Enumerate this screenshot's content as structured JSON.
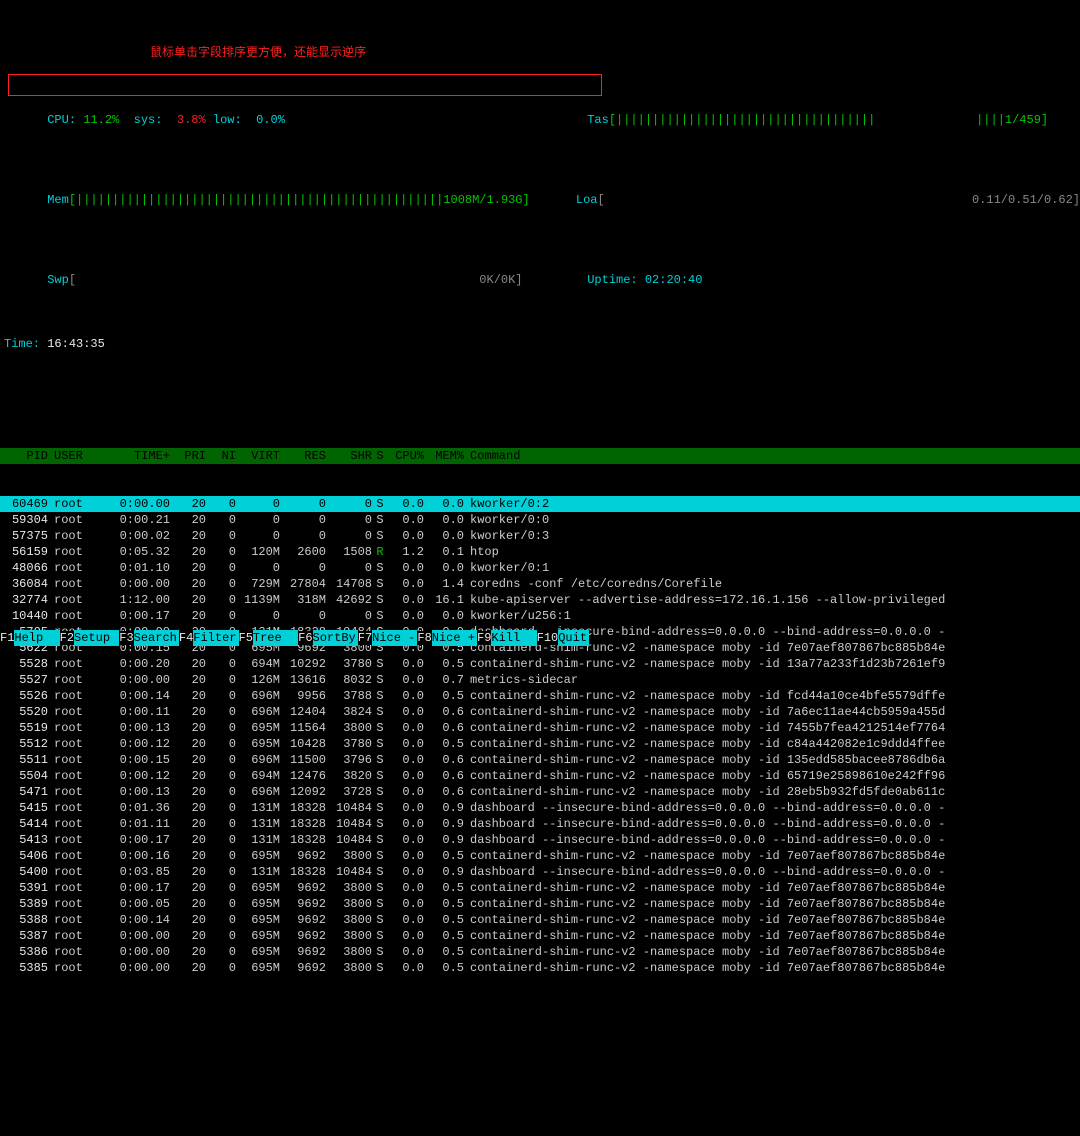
{
  "meters": {
    "cpu_label": "CPU:",
    "cpu_user": "11.2%",
    "sys_label": "sys:",
    "sys_val": "3.8%",
    "low_label": "low:",
    "low_val": "0.0%",
    "tas_label": "Tas",
    "tas_bar": "[||||||||||||||||||||||||||||||||||||              ||||1/459]",
    "mem_label": "Mem",
    "mem_bar": "[|||||||||||||||||||||||||||||||||||||||||||||||||||1008M/1.93G]",
    "mem_right": "0.11/0.51/0.62]",
    "loa_label": "Loa",
    "loa_bar": "[                                                   ",
    "swp_label": "Swp",
    "swp_bar": "[                                                        0K/0K]",
    "uptime_label": "Uptime:",
    "uptime_val": "02:20:40",
    "time_label": "Time:",
    "time_val": "16:43:35"
  },
  "annotation": "鼠标单击字段排序更方便，还能显示逆序",
  "columns": {
    "pid": "PID",
    "user": "USER",
    "time": "TIME+",
    "pri": "PRI",
    "ni": "NI",
    "virt": "VIRT",
    "res": "RES",
    "shr": "SHR",
    "s": "S",
    "cpu": "CPU%",
    "mem": "MEM%",
    "cmd": "Command"
  },
  "processes": [
    {
      "pid": "60469",
      "user": "root",
      "time": "0:00.00",
      "pri": "20",
      "ni": "0",
      "virt": "0",
      "res": "0",
      "shr": "0",
      "s": "S",
      "cpu": "0.0",
      "mem": "0.0",
      "cmd": "kworker/0:2",
      "hl": true
    },
    {
      "pid": "59304",
      "user": "root",
      "time": "0:00.21",
      "pri": "20",
      "ni": "0",
      "virt": "0",
      "res": "0",
      "shr": "0",
      "s": "S",
      "cpu": "0.0",
      "mem": "0.0",
      "cmd": "kworker/0:0"
    },
    {
      "pid": "57375",
      "user": "root",
      "time": "0:00.02",
      "pri": "20",
      "ni": "0",
      "virt": "0",
      "res": "0",
      "shr": "0",
      "s": "S",
      "cpu": "0.0",
      "mem": "0.0",
      "cmd": "kworker/0:3"
    },
    {
      "pid": "56159",
      "user": "root",
      "time": "0:05.32",
      "pri": "20",
      "ni": "0",
      "virt": "120M",
      "res": "2600",
      "shr": "1508",
      "s": "R",
      "cpu": "1.2",
      "mem": "0.1",
      "cmd": "htop",
      "run": true
    },
    {
      "pid": "48066",
      "user": "root",
      "time": "0:01.10",
      "pri": "20",
      "ni": "0",
      "virt": "0",
      "res": "0",
      "shr": "0",
      "s": "S",
      "cpu": "0.0",
      "mem": "0.0",
      "cmd": "kworker/0:1"
    },
    {
      "pid": "36084",
      "user": "root",
      "time": "0:00.00",
      "pri": "20",
      "ni": "0",
      "virt": "729M",
      "res": "27804",
      "shr": "14708",
      "s": "S",
      "cpu": "0.0",
      "mem": "1.4",
      "cmd": "coredns -conf /etc/coredns/Corefile"
    },
    {
      "pid": "32774",
      "user": "root",
      "time": "1:12.00",
      "pri": "20",
      "ni": "0",
      "virt": "1139M",
      "res": "318M",
      "shr": "42692",
      "s": "S",
      "cpu": "0.0",
      "mem": "16.1",
      "cmd": "kube-apiserver --advertise-address=172.16.1.156 --allow-privileged"
    },
    {
      "pid": "10440",
      "user": "root",
      "time": "0:00.17",
      "pri": "20",
      "ni": "0",
      "virt": "0",
      "res": "0",
      "shr": "0",
      "s": "S",
      "cpu": "0.0",
      "mem": "0.0",
      "cmd": "kworker/u256:1"
    },
    {
      "pid": "5705",
      "user": "root",
      "time": "0:00.00",
      "pri": "20",
      "ni": "0",
      "virt": "131M",
      "res": "18328",
      "shr": "10484",
      "s": "S",
      "cpu": "0.0",
      "mem": "0.9",
      "cmd": "dashboard --insecure-bind-address=0.0.0.0 --bind-address=0.0.0.0 -"
    },
    {
      "pid": "5622",
      "user": "root",
      "time": "0:00.15",
      "pri": "20",
      "ni": "0",
      "virt": "695M",
      "res": "9692",
      "shr": "3800",
      "s": "S",
      "cpu": "0.0",
      "mem": "0.5",
      "cmd": "containerd-shim-runc-v2 -namespace moby -id 7e07aef807867bc885b84e"
    },
    {
      "pid": "5528",
      "user": "root",
      "time": "0:00.20",
      "pri": "20",
      "ni": "0",
      "virt": "694M",
      "res": "10292",
      "shr": "3780",
      "s": "S",
      "cpu": "0.0",
      "mem": "0.5",
      "cmd": "containerd-shim-runc-v2 -namespace moby -id 13a77a233f1d23b7261ef9"
    },
    {
      "pid": "5527",
      "user": "root",
      "time": "0:00.00",
      "pri": "20",
      "ni": "0",
      "virt": "126M",
      "res": "13616",
      "shr": "8032",
      "s": "S",
      "cpu": "0.0",
      "mem": "0.7",
      "cmd": "metrics-sidecar"
    },
    {
      "pid": "5526",
      "user": "root",
      "time": "0:00.14",
      "pri": "20",
      "ni": "0",
      "virt": "696M",
      "res": "9956",
      "shr": "3788",
      "s": "S",
      "cpu": "0.0",
      "mem": "0.5",
      "cmd": "containerd-shim-runc-v2 -namespace moby -id fcd44a10ce4bfe5579dffe"
    },
    {
      "pid": "5520",
      "user": "root",
      "time": "0:00.11",
      "pri": "20",
      "ni": "0",
      "virt": "696M",
      "res": "12404",
      "shr": "3824",
      "s": "S",
      "cpu": "0.0",
      "mem": "0.6",
      "cmd": "containerd-shim-runc-v2 -namespace moby -id 7a6ec11ae44cb5959a455d"
    },
    {
      "pid": "5519",
      "user": "root",
      "time": "0:00.13",
      "pri": "20",
      "ni": "0",
      "virt": "695M",
      "res": "11564",
      "shr": "3800",
      "s": "S",
      "cpu": "0.0",
      "mem": "0.6",
      "cmd": "containerd-shim-runc-v2 -namespace moby -id 7455b7fea4212514ef7764"
    },
    {
      "pid": "5512",
      "user": "root",
      "time": "0:00.12",
      "pri": "20",
      "ni": "0",
      "virt": "695M",
      "res": "10428",
      "shr": "3780",
      "s": "S",
      "cpu": "0.0",
      "mem": "0.5",
      "cmd": "containerd-shim-runc-v2 -namespace moby -id c84a442082e1c9ddd4ffee"
    },
    {
      "pid": "5511",
      "user": "root",
      "time": "0:00.15",
      "pri": "20",
      "ni": "0",
      "virt": "696M",
      "res": "11500",
      "shr": "3796",
      "s": "S",
      "cpu": "0.0",
      "mem": "0.6",
      "cmd": "containerd-shim-runc-v2 -namespace moby -id 135edd585bacee8786db6a"
    },
    {
      "pid": "5504",
      "user": "root",
      "time": "0:00.12",
      "pri": "20",
      "ni": "0",
      "virt": "694M",
      "res": "12476",
      "shr": "3820",
      "s": "S",
      "cpu": "0.0",
      "mem": "0.6",
      "cmd": "containerd-shim-runc-v2 -namespace moby -id 65719e25898610e242ff96"
    },
    {
      "pid": "5471",
      "user": "root",
      "time": "0:00.13",
      "pri": "20",
      "ni": "0",
      "virt": "696M",
      "res": "12092",
      "shr": "3728",
      "s": "S",
      "cpu": "0.0",
      "mem": "0.6",
      "cmd": "containerd-shim-runc-v2 -namespace moby -id 28eb5b932fd5fde0ab611c"
    },
    {
      "pid": "5415",
      "user": "root",
      "time": "0:01.36",
      "pri": "20",
      "ni": "0",
      "virt": "131M",
      "res": "18328",
      "shr": "10484",
      "s": "S",
      "cpu": "0.0",
      "mem": "0.9",
      "cmd": "dashboard --insecure-bind-address=0.0.0.0 --bind-address=0.0.0.0 -"
    },
    {
      "pid": "5414",
      "user": "root",
      "time": "0:01.11",
      "pri": "20",
      "ni": "0",
      "virt": "131M",
      "res": "18328",
      "shr": "10484",
      "s": "S",
      "cpu": "0.0",
      "mem": "0.9",
      "cmd": "dashboard --insecure-bind-address=0.0.0.0 --bind-address=0.0.0.0 -"
    },
    {
      "pid": "5413",
      "user": "root",
      "time": "0:00.17",
      "pri": "20",
      "ni": "0",
      "virt": "131M",
      "res": "18328",
      "shr": "10484",
      "s": "S",
      "cpu": "0.0",
      "mem": "0.9",
      "cmd": "dashboard --insecure-bind-address=0.0.0.0 --bind-address=0.0.0.0 -"
    },
    {
      "pid": "5406",
      "user": "root",
      "time": "0:00.16",
      "pri": "20",
      "ni": "0",
      "virt": "695M",
      "res": "9692",
      "shr": "3800",
      "s": "S",
      "cpu": "0.0",
      "mem": "0.5",
      "cmd": "containerd-shim-runc-v2 -namespace moby -id 7e07aef807867bc885b84e"
    },
    {
      "pid": "5400",
      "user": "root",
      "time": "0:03.85",
      "pri": "20",
      "ni": "0",
      "virt": "131M",
      "res": "18328",
      "shr": "10484",
      "s": "S",
      "cpu": "0.0",
      "mem": "0.9",
      "cmd": "dashboard --insecure-bind-address=0.0.0.0 --bind-address=0.0.0.0 -"
    },
    {
      "pid": "5391",
      "user": "root",
      "time": "0:00.17",
      "pri": "20",
      "ni": "0",
      "virt": "695M",
      "res": "9692",
      "shr": "3800",
      "s": "S",
      "cpu": "0.0",
      "mem": "0.5",
      "cmd": "containerd-shim-runc-v2 -namespace moby -id 7e07aef807867bc885b84e"
    },
    {
      "pid": "5389",
      "user": "root",
      "time": "0:00.05",
      "pri": "20",
      "ni": "0",
      "virt": "695M",
      "res": "9692",
      "shr": "3800",
      "s": "S",
      "cpu": "0.0",
      "mem": "0.5",
      "cmd": "containerd-shim-runc-v2 -namespace moby -id 7e07aef807867bc885b84e"
    },
    {
      "pid": "5388",
      "user": "root",
      "time": "0:00.14",
      "pri": "20",
      "ni": "0",
      "virt": "695M",
      "res": "9692",
      "shr": "3800",
      "s": "S",
      "cpu": "0.0",
      "mem": "0.5",
      "cmd": "containerd-shim-runc-v2 -namespace moby -id 7e07aef807867bc885b84e"
    },
    {
      "pid": "5387",
      "user": "root",
      "time": "0:00.00",
      "pri": "20",
      "ni": "0",
      "virt": "695M",
      "res": "9692",
      "shr": "3800",
      "s": "S",
      "cpu": "0.0",
      "mem": "0.5",
      "cmd": "containerd-shim-runc-v2 -namespace moby -id 7e07aef807867bc885b84e"
    },
    {
      "pid": "5386",
      "user": "root",
      "time": "0:00.00",
      "pri": "20",
      "ni": "0",
      "virt": "695M",
      "res": "9692",
      "shr": "3800",
      "s": "S",
      "cpu": "0.0",
      "mem": "0.5",
      "cmd": "containerd-shim-runc-v2 -namespace moby -id 7e07aef807867bc885b84e"
    },
    {
      "pid": "5385",
      "user": "root",
      "time": "0:00.00",
      "pri": "20",
      "ni": "0",
      "virt": "695M",
      "res": "9692",
      "shr": "3800",
      "s": "S",
      "cpu": "0.0",
      "mem": "0.5",
      "cmd": "containerd-shim-runc-v2 -namespace moby -id 7e07aef807867bc885b84e"
    }
  ],
  "fkeys": [
    {
      "n": "F1",
      "l": "Help  "
    },
    {
      "n": "F2",
      "l": "Setup "
    },
    {
      "n": "F3",
      "l": "Search"
    },
    {
      "n": "F4",
      "l": "Filter"
    },
    {
      "n": "F5",
      "l": "Tree  "
    },
    {
      "n": "F6",
      "l": "SortBy"
    },
    {
      "n": "F7",
      "l": "Nice -"
    },
    {
      "n": "F8",
      "l": "Nice +"
    },
    {
      "n": "F9",
      "l": "Kill  "
    },
    {
      "n": "F10",
      "l": "Quit"
    }
  ]
}
